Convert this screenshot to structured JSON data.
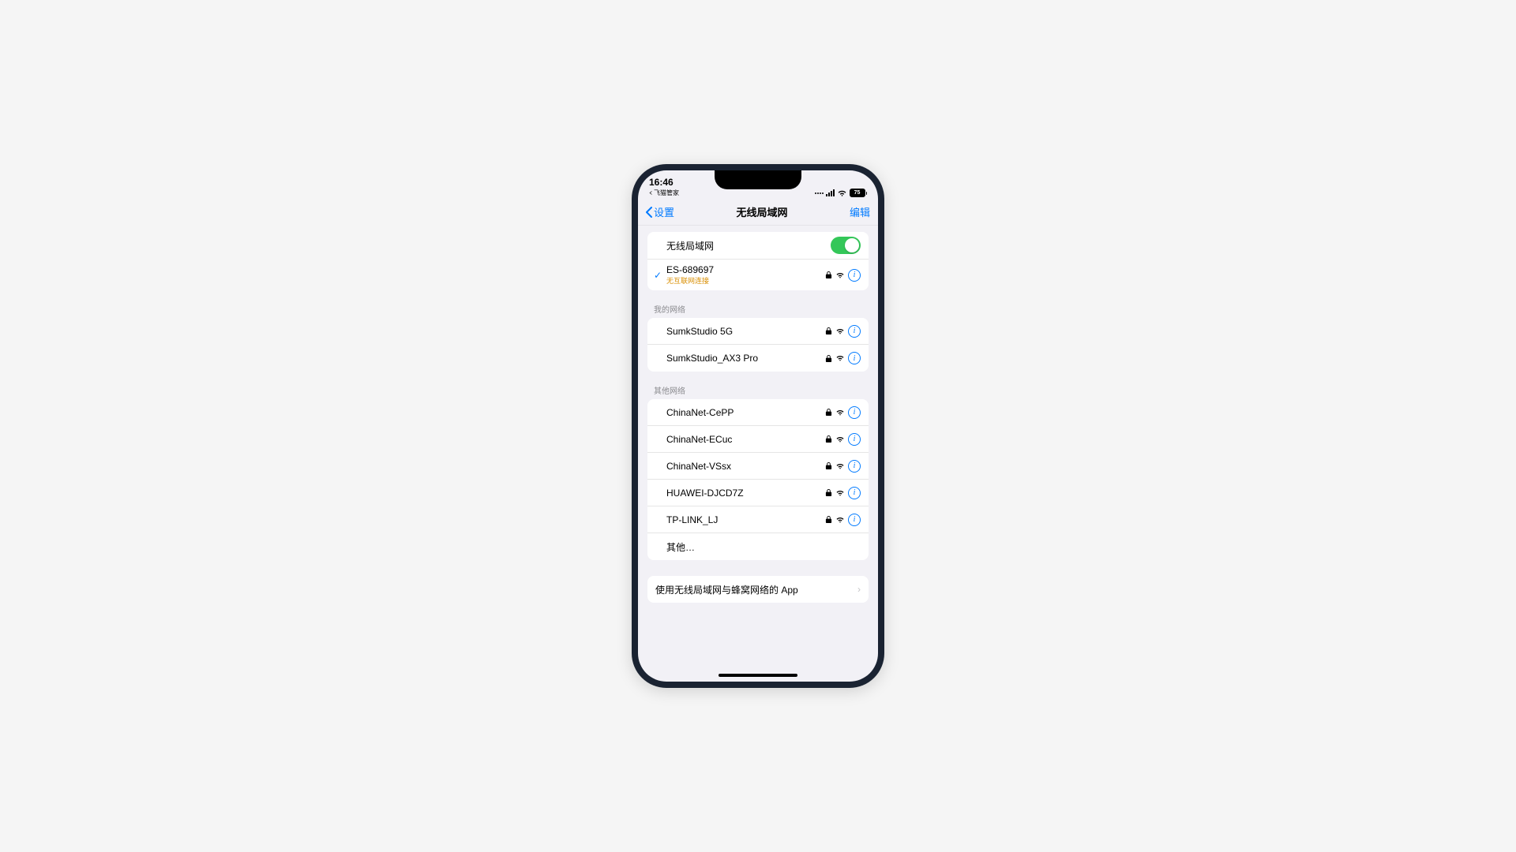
{
  "status": {
    "time": "16:46",
    "breadcrumb": "飞猫管家",
    "battery": "75"
  },
  "nav": {
    "back": "设置",
    "title": "无线局域网",
    "edit": "编辑"
  },
  "wifi_toggle_label": "无线局域网",
  "connected": {
    "name": "ES-689697",
    "status": "无互联网连接"
  },
  "my_networks_label": "我的网络",
  "my_networks": [
    {
      "name": "SumkStudio 5G"
    },
    {
      "name": "SumkStudio_AX3 Pro"
    }
  ],
  "other_networks_label": "其他网络",
  "other_networks": [
    {
      "name": "ChinaNet-CePP"
    },
    {
      "name": "ChinaNet-ECuc"
    },
    {
      "name": "ChinaNet-VSsx"
    },
    {
      "name": "HUAWEI-DJCD7Z"
    },
    {
      "name": "TP-LINK_LJ"
    }
  ],
  "other_option": "其他…",
  "footer": "使用无线局域网与蜂窝网络的 App"
}
